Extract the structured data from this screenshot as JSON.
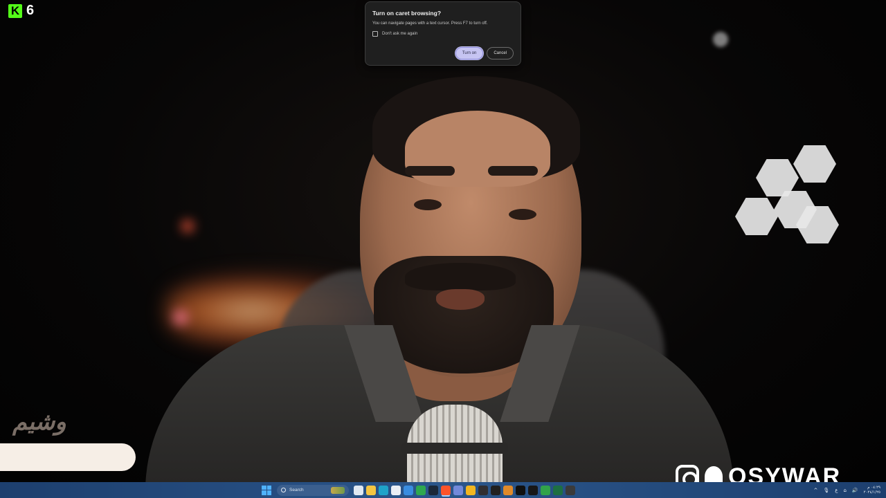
{
  "overlay": {
    "kick_number": "6",
    "kick_letter": "K",
    "arabic_logo": "وشيم",
    "social_handle": "OSYWAR",
    "colors": {
      "kick_green": "#53fc18",
      "bar_cream": "#f6eee6"
    }
  },
  "dialog": {
    "title": "Turn on caret browsing?",
    "body": "You can navigate pages with a text cursor. Press F7 to turn off.",
    "checkbox_label": "Don't ask me again",
    "checkbox_checked": false,
    "primary_button": "Turn on",
    "secondary_button": "Cancel",
    "colors": {
      "primary_bg": "#c6c4f2",
      "surface": "#1f1f1f"
    }
  },
  "taskbar": {
    "search_placeholder": "Search",
    "apps": [
      {
        "name": "task-view-icon",
        "color": "#dfe8f2"
      },
      {
        "name": "file-explorer-icon",
        "color": "#f4c542"
      },
      {
        "name": "edge-icon",
        "color": "#1fa3c9"
      },
      {
        "name": "store-icon",
        "color": "#e9eef5"
      },
      {
        "name": "photos-icon",
        "color": "#3a8de0"
      },
      {
        "name": "xbox-icon",
        "color": "#2fa84f"
      },
      {
        "name": "steam-icon",
        "color": "#1b2838"
      },
      {
        "name": "brave-icon",
        "color": "#fb542b"
      },
      {
        "name": "discord-icon",
        "color": "#7289da"
      },
      {
        "name": "chrome-canary-icon",
        "color": "#f2b620"
      },
      {
        "name": "obs-icon",
        "color": "#302e31"
      },
      {
        "name": "terminal-icon",
        "color": "#202020"
      },
      {
        "name": "affinity-icon",
        "color": "#e08a2a"
      },
      {
        "name": "unity-icon",
        "color": "#101010"
      },
      {
        "name": "github-icon",
        "color": "#181717"
      },
      {
        "name": "xbox-app-icon",
        "color": "#31a34a"
      },
      {
        "name": "excel-icon",
        "color": "#1d6f42"
      },
      {
        "name": "media-player-icon",
        "color": "#3a3a3a"
      }
    ],
    "tray": {
      "chevron": "^",
      "mic": "🎙",
      "ime": "ع",
      "network": "⌂",
      "volume": "🔊",
      "time": "٠٤:٢٩ م",
      "date": "٢٠٢٤/١/٢٥"
    }
  }
}
